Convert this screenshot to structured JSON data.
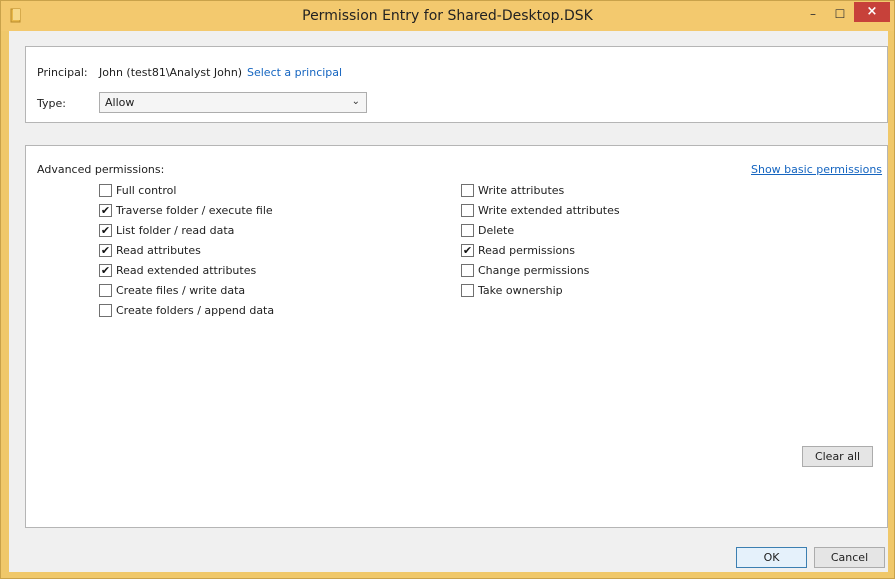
{
  "window": {
    "title": "Permission Entry for Shared-Desktop.DSK",
    "minimize_glyph": "–",
    "maximize_glyph": "☐",
    "close_glyph": "×"
  },
  "principal": {
    "label": "Principal:",
    "value": "John (test81\\Analyst John)",
    "select_link": "Select a principal"
  },
  "type": {
    "label": "Type:",
    "selected": "Allow"
  },
  "advanced": {
    "heading": "Advanced permissions:",
    "show_basic_link": "Show basic permissions",
    "left": [
      {
        "label": "Full control",
        "checked": false
      },
      {
        "label": "Traverse folder / execute file",
        "checked": true
      },
      {
        "label": "List folder / read data",
        "checked": true
      },
      {
        "label": "Read attributes",
        "checked": true
      },
      {
        "label": "Read extended attributes",
        "checked": true
      },
      {
        "label": "Create files / write data",
        "checked": false
      },
      {
        "label": "Create folders / append data",
        "checked": false
      }
    ],
    "right": [
      {
        "label": "Write attributes",
        "checked": false
      },
      {
        "label": "Write extended attributes",
        "checked": false
      },
      {
        "label": "Delete",
        "checked": false
      },
      {
        "label": "Read permissions",
        "checked": true
      },
      {
        "label": "Change permissions",
        "checked": false
      },
      {
        "label": "Take ownership",
        "checked": false
      }
    ],
    "clear_all_label": "Clear all"
  },
  "footer": {
    "ok_label": "OK",
    "cancel_label": "Cancel"
  }
}
